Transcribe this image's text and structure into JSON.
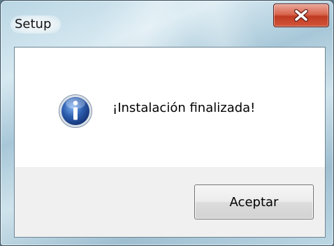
{
  "window": {
    "title": "Setup",
    "close_icon": "close-icon"
  },
  "dialog": {
    "icon": "info-icon",
    "message": "¡Instalación finalizada!",
    "ok_label": "Aceptar"
  },
  "colors": {
    "close_button": "#c94a30",
    "info_icon": "#2d5fb0",
    "frame": "#b9d6e4"
  }
}
